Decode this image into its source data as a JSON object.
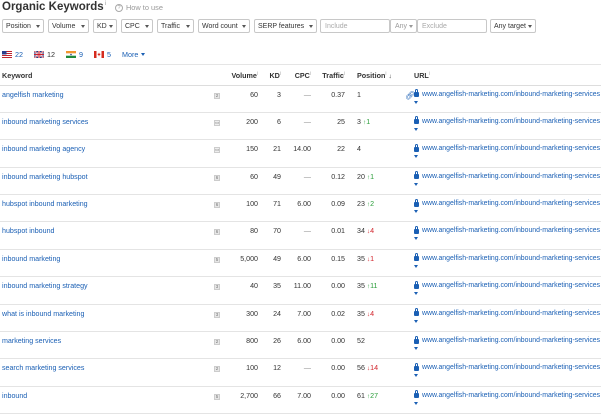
{
  "page": {
    "title": "Organic Keywords",
    "title_sup": "i",
    "howto_icon": "question-icon",
    "howto_label": "How to use"
  },
  "filters": {
    "buttons": [
      "Position",
      "Volume",
      "KD",
      "CPC",
      "Traffic",
      "Word count",
      "SERP features"
    ],
    "include_placeholder": "Include",
    "any_label": "Any",
    "exclude_placeholder": "Exclude",
    "any_target_label": "Any target"
  },
  "countries": [
    {
      "flag": "us-flag",
      "count": "22",
      "active": false
    },
    {
      "flag": "uk-flag",
      "count": "12",
      "active": true
    },
    {
      "flag": "in-flag",
      "count": "9",
      "active": false
    },
    {
      "flag": "ca-flag",
      "count": "5",
      "active": false
    }
  ],
  "more_label": "More",
  "table": {
    "headers": {
      "keyword": "Keyword",
      "volume": "Volume",
      "kd": "KD",
      "cpc": "CPC",
      "traffic": "Traffic",
      "position": "Position",
      "url": "URL"
    },
    "rows": [
      {
        "keyword": "angelfish marketing",
        "serp": "2",
        "volume": "60",
        "kd": "3",
        "cpc": "—",
        "traffic": "0.37",
        "position": "1",
        "change": "",
        "dir": "",
        "url": "www.angelfish-marketing.com/inbound-marketing-services",
        "link_icon": true
      },
      {
        "keyword": "inbound marketing services",
        "serp": "img",
        "volume": "200",
        "kd": "6",
        "cpc": "—",
        "traffic": "25",
        "position": "3",
        "change": "1",
        "dir": "up",
        "url": "www.angelfish-marketing.com/inbound-marketing-services",
        "link_icon": false
      },
      {
        "keyword": "inbound marketing agency",
        "serp": "img",
        "volume": "150",
        "kd": "21",
        "cpc": "14.00",
        "traffic": "22",
        "position": "4",
        "change": "",
        "dir": "",
        "url": "www.angelfish-marketing.com/inbound-marketing-services",
        "link_icon": false
      },
      {
        "keyword": "inbound marketing hubspot",
        "serp": "6",
        "volume": "60",
        "kd": "49",
        "cpc": "—",
        "traffic": "0.12",
        "position": "20",
        "change": "1",
        "dir": "up",
        "url": "www.angelfish-marketing.com/inbound-marketing-services",
        "link_icon": false
      },
      {
        "keyword": "hubspot inbound marketing",
        "serp": "6",
        "volume": "100",
        "kd": "71",
        "cpc": "6.00",
        "traffic": "0.09",
        "position": "23",
        "change": "2",
        "dir": "up",
        "url": "www.angelfish-marketing.com/inbound-marketing-services",
        "link_icon": false
      },
      {
        "keyword": "hubspot inbound",
        "serp": "6",
        "volume": "80",
        "kd": "70",
        "cpc": "—",
        "traffic": "0.01",
        "position": "34",
        "change": "4",
        "dir": "down",
        "url": "www.angelfish-marketing.com/inbound-marketing-services",
        "link_icon": false
      },
      {
        "keyword": "inbound marketing",
        "serp": "5",
        "volume": "5,000",
        "kd": "49",
        "cpc": "6.00",
        "traffic": "0.15",
        "position": "35",
        "change": "1",
        "dir": "down",
        "url": "www.angelfish-marketing.com/inbound-marketing-services",
        "link_icon": false
      },
      {
        "keyword": "inbound marketing strategy",
        "serp": "3",
        "volume": "40",
        "kd": "35",
        "cpc": "11.00",
        "traffic": "0.00",
        "position": "35",
        "change": "11",
        "dir": "up",
        "url": "www.angelfish-marketing.com/inbound-marketing-services",
        "link_icon": false
      },
      {
        "keyword": "what is inbound marketing",
        "serp": "3",
        "volume": "300",
        "kd": "24",
        "cpc": "7.00",
        "traffic": "0.02",
        "position": "35",
        "change": "4",
        "dir": "down",
        "url": "www.angelfish-marketing.com/inbound-marketing-services",
        "link_icon": false
      },
      {
        "keyword": "marketing services",
        "serp": "2",
        "volume": "800",
        "kd": "26",
        "cpc": "6.00",
        "traffic": "0.00",
        "position": "52",
        "change": "",
        "dir": "",
        "url": "www.angelfish-marketing.com/inbound-marketing-services",
        "link_icon": false
      },
      {
        "keyword": "search marketing services",
        "serp": "2",
        "volume": "100",
        "kd": "12",
        "cpc": "—",
        "traffic": "0.00",
        "position": "56",
        "change": "14",
        "dir": "down",
        "url": "www.angelfish-marketing.com/inbound-marketing-services",
        "link_icon": false
      },
      {
        "keyword": "inbound",
        "serp": "5",
        "volume": "2,700",
        "kd": "66",
        "cpc": "7.00",
        "traffic": "0.00",
        "position": "61",
        "change": "27",
        "dir": "up",
        "url": "www.angelfish-marketing.com/inbound-marketing-services",
        "link_icon": false
      }
    ]
  }
}
